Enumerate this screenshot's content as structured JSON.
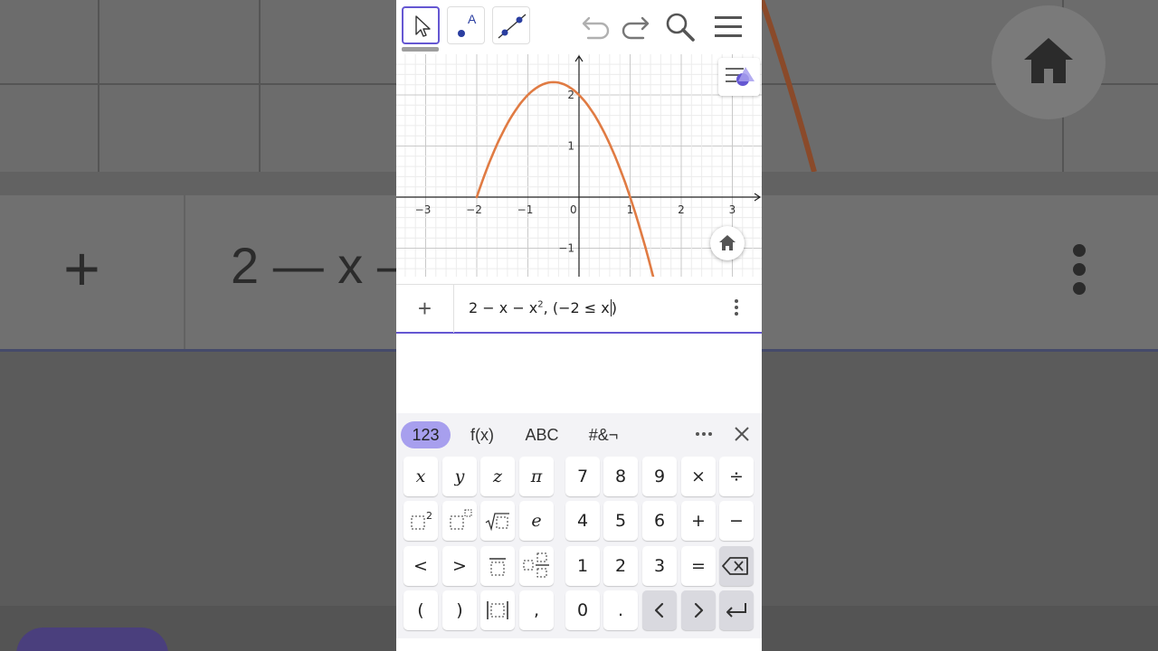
{
  "background": {
    "expression_preview": "2 — x —"
  },
  "toolbar": {
    "tools": [
      "move-tool",
      "point-tool",
      "line-tool"
    ],
    "point_tool_label": "A"
  },
  "graph": {
    "x_tick_labels": [
      "−3",
      "−2",
      "−1",
      "0",
      "1",
      "2",
      "3"
    ],
    "y_tick_labels": [
      "2",
      "1",
      "−1"
    ],
    "curve_color": "#e07b43"
  },
  "chart_data": {
    "type": "line",
    "series": [
      {
        "x": [
          -2,
          -1.75,
          -1.5,
          -1.25,
          -1,
          -0.75,
          -0.5,
          -0.25,
          0,
          0.25,
          0.5,
          0.75,
          1,
          1.25,
          1.5
        ],
        "y": [
          0,
          0.6875,
          1.25,
          1.6875,
          2,
          2.1875,
          2.25,
          2.1875,
          2,
          1.6875,
          1.25,
          0.6875,
          0,
          -0.8125,
          -1.75
        ]
      }
    ],
    "xlim": [
      -3.5,
      3.5
    ],
    "ylim": [
      -1.55,
      2.75
    ],
    "grid": true
  },
  "algebra": {
    "expr_main": "2 − x − x",
    "expr_sup": "2",
    "expr_tail": ", (−2 ≤ x",
    "expr_close": ")"
  },
  "keyboard": {
    "tabs": [
      "123",
      "f(x)",
      "ABC",
      "#&¬"
    ],
    "active_tab": "123",
    "left_keys": [
      [
        "x",
        "y",
        "z",
        "π"
      ],
      [
        "square",
        "power",
        "sqrt",
        "e"
      ],
      [
        "<",
        ">",
        "fraction",
        "mixed-number"
      ],
      [
        "(",
        ")",
        "abs",
        ","
      ]
    ],
    "right_keys": [
      [
        "7",
        "8",
        "9",
        "×",
        "÷"
      ],
      [
        "4",
        "5",
        "6",
        "+",
        "−"
      ],
      [
        "1",
        "2",
        "3",
        "=",
        "backspace"
      ],
      [
        "0",
        ".",
        "left",
        "right",
        "enter"
      ]
    ],
    "accent": "#a79fee"
  }
}
